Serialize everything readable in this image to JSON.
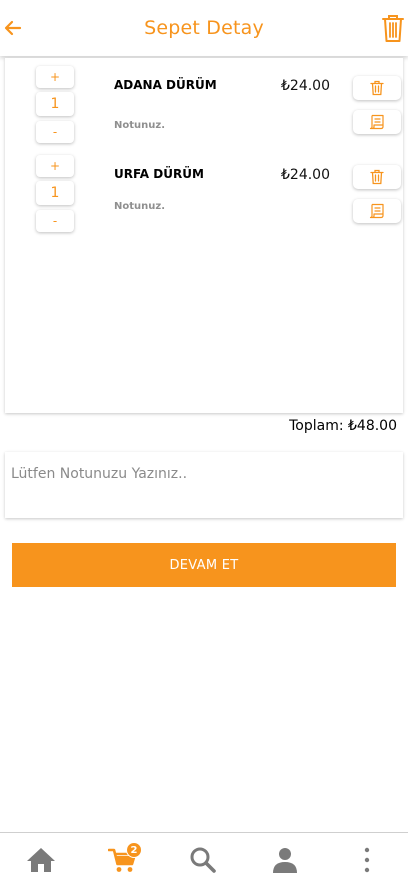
{
  "header": {
    "title": "Sepet Detay",
    "back_icon": "arrow-left-icon",
    "clear_icon": "trash-icon"
  },
  "cart": {
    "items": [
      {
        "name": "ADANA DÜRÜM",
        "price": "₺24.00",
        "quantity": "1",
        "note": "Notunuz.",
        "plus": "+",
        "minus": "-"
      },
      {
        "name": "URFA DÜRÜM",
        "price": "₺24.00",
        "quantity": "1",
        "note": "Notunuz.",
        "plus": "+",
        "minus": "-"
      }
    ],
    "total": "Toplam: ₺48.00"
  },
  "note": {
    "placeholder": "Lütfen Notunuzu Yazınız.."
  },
  "continue_label": "DEVAM ET",
  "nav": {
    "items": [
      "home-icon",
      "cart-icon",
      "search-icon",
      "user-icon",
      "more-vertical-icon"
    ],
    "cart_badge": "2"
  },
  "colors": {
    "accent": "#F7941D",
    "nav_icon": "#7a7a7a"
  }
}
